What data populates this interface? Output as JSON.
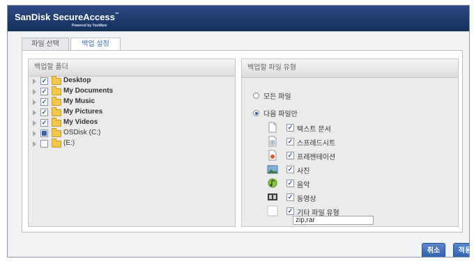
{
  "app": {
    "logo_text": "SanDisk SecureAccess",
    "logo_subtitle": "Powered by YouWare"
  },
  "tabs": [
    {
      "label": "파일 선택"
    },
    {
      "label": "백업 설정"
    }
  ],
  "left_panel": {
    "header": "백업할 폴더",
    "folders": [
      {
        "label": "Desktop",
        "checked": true
      },
      {
        "label": "My Documents",
        "checked": true
      },
      {
        "label": "My Music",
        "checked": true
      },
      {
        "label": "My Pictures",
        "checked": true
      },
      {
        "label": "My Videos",
        "checked": true
      },
      {
        "label": "OSDisk (C:)",
        "state": "partial"
      },
      {
        "label": "(E:)",
        "checked": false
      }
    ]
  },
  "right_panel": {
    "header": "백업할 파일 유형",
    "option_all": "모든 파일",
    "option_only": "다음 파일만",
    "selected_option": "only",
    "file_types": [
      {
        "label": "텍스트 문서",
        "icon": "document-icon",
        "checked": true
      },
      {
        "label": "스프레드시트",
        "icon": "spreadsheet-icon",
        "checked": true
      },
      {
        "label": "프레젠테이션",
        "icon": "presentation-icon",
        "checked": true
      },
      {
        "label": "사진",
        "icon": "photo-icon",
        "checked": true
      },
      {
        "label": "음악",
        "icon": "music-icon",
        "checked": true
      },
      {
        "label": "동영상",
        "icon": "video-icon",
        "checked": true
      },
      {
        "label": "기타 파일 유형",
        "icon": "blank-icon",
        "checked": true
      }
    ],
    "other_extensions_value": "zip,rar"
  },
  "buttons": {
    "cancel": "취소",
    "apply": "적용"
  },
  "colors": {
    "titlebar": "#1e3b6c",
    "button": "#2e5eac",
    "folder": "#f1c84b"
  }
}
